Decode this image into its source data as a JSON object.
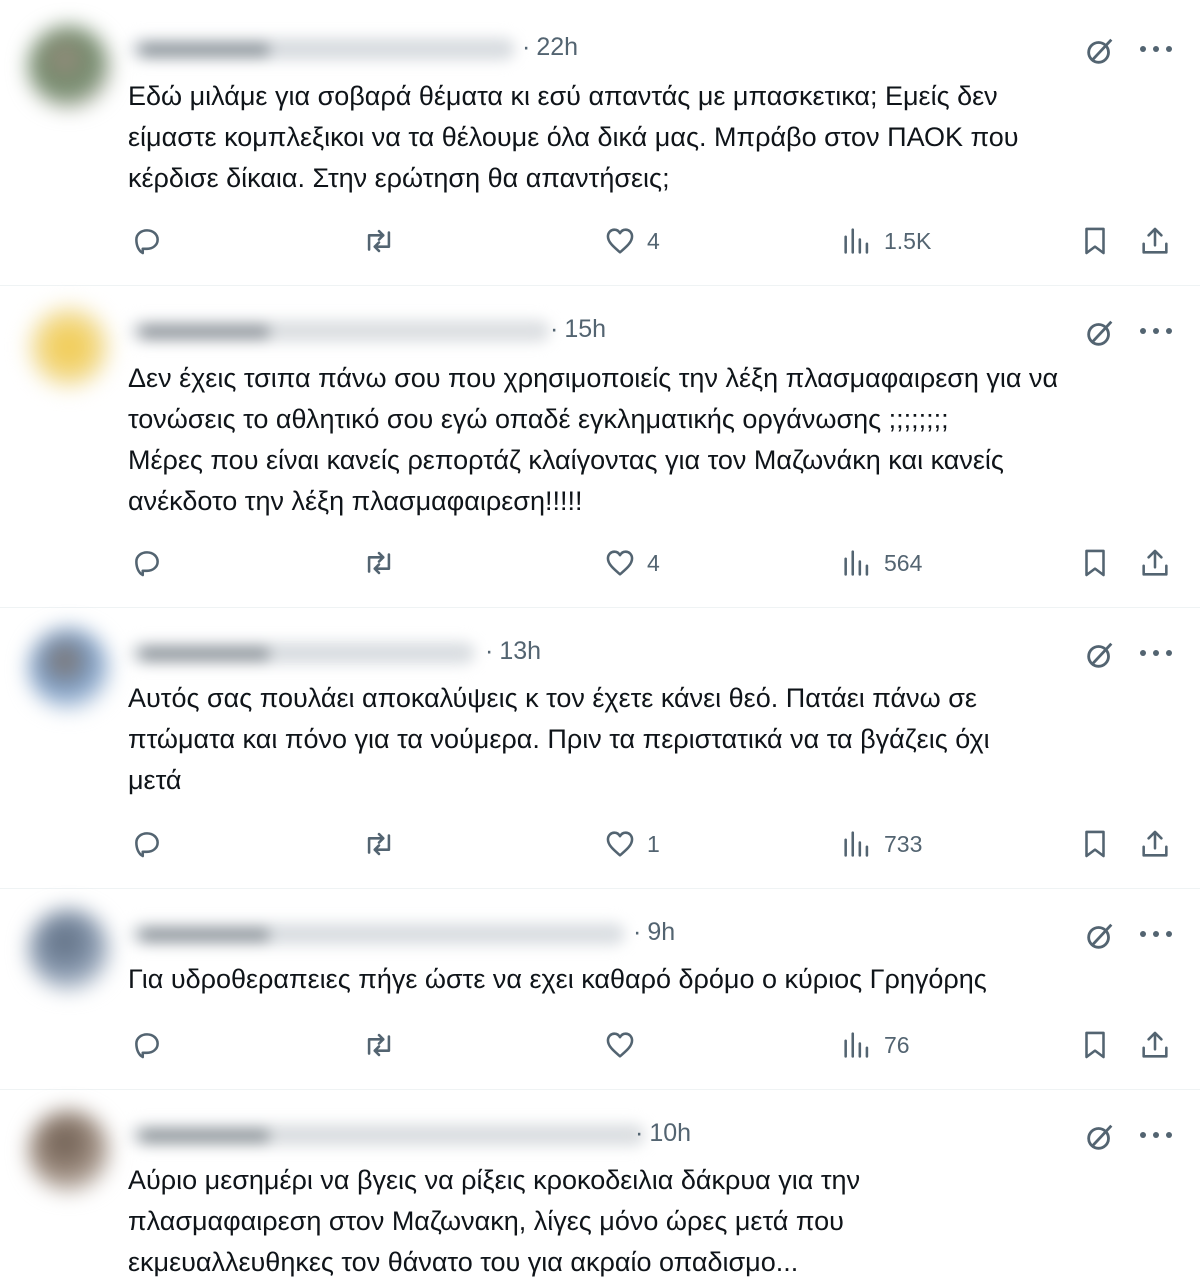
{
  "colors": {
    "text": "#0f1419",
    "secondary": "#536471",
    "divider": "#eff3f4"
  },
  "icons": {
    "reply": "reply-icon",
    "repost": "repost-icon",
    "like": "heart-icon",
    "views": "analytics-icon",
    "bookmark": "bookmark-icon",
    "share": "share-icon",
    "grok": "grok-icon",
    "more": "more-icon"
  },
  "replies": [
    {
      "author_name": "",
      "time": "22h",
      "text": "Εδώ μιλάμε για σοβαρά θέματα κι εσύ απαντάς με μπασκετικα; Εμείς δεν\nείμαστε κομπλεξικοι να τα θέλουμε όλα δικά μας. Μπράβο στον ΠΑΟΚ που\nκέρδισε δίκαια. Στην ερώτηση θα απαντήσεις;",
      "likes": "4",
      "views": "1.5K"
    },
    {
      "author_name": "",
      "time": "15h",
      "text": "Δεν έχεις τσιπα πάνω σου που χρησιμοποιείς την λέξη πλασμαφαιρεση για να\nτονώσεις το αθλητικό σου εγώ οπαδέ εγκληματικής οργάνωσης ;;;;;;;;\nΜέρες που είναι κανείς ρεπορτάζ κλαίγοντας για τον Μαζωνάκη και κανείς\nανέκδοτο την λέξη πλασμαφαιρεση!!!!!",
      "likes": "4",
      "views": "564"
    },
    {
      "author_name": "",
      "time": "13h",
      "text": "Αυτός σας πουλάει αποκαλύψεις κ τον έχετε κάνει θεό. Πατάει πάνω σε\nπτώματα και πόνο για τα νούμερα. Πριν τα περιστατικά να τα βγάζεις όχι\nμετά",
      "likes": "1",
      "views": "733"
    },
    {
      "author_name": "",
      "time": "9h",
      "text": "Για υδροθεραπειες πήγε ώστε να εχει καθαρό δρόμο ο κύριος Γρηγόρης",
      "likes": "",
      "views": "76"
    },
    {
      "author_name": "",
      "time": "10h",
      "text": "Αύριο μεσημέρι να βγεις να ρίξεις κροκοδειλια δάκρυα για την\nπλασμαφαιρεση στον Μαζωνακη, λίγες μόνο ώρες μετά που\nεκμευαλλευθηκες τον θάνατο του για ακραίο οπαδισμο...",
      "likes": "",
      "views": ""
    }
  ]
}
